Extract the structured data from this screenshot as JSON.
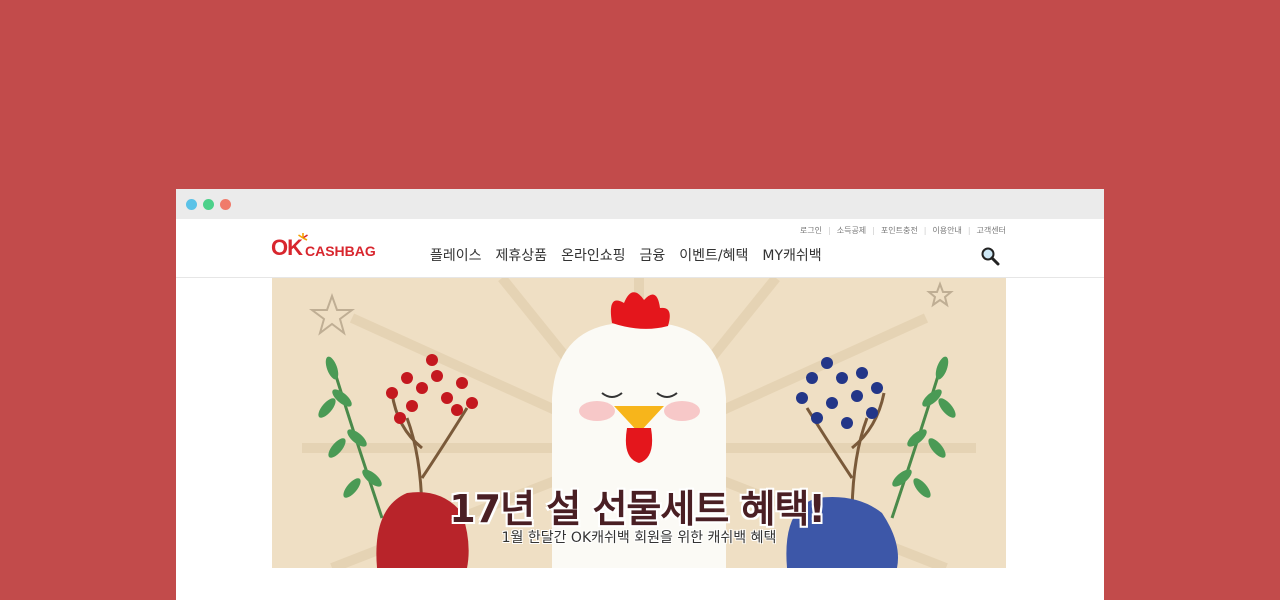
{
  "window": {
    "controls": [
      "close",
      "minimize",
      "maximize"
    ]
  },
  "utility_links": [
    "로그인",
    "소득공제",
    "포인트충전",
    "이용안내",
    "고객센터"
  ],
  "logo": {
    "ok": "OK",
    "cashbag": "CASHBAG"
  },
  "nav": [
    "플레이스",
    "제휴상품",
    "온라인쇼핑",
    "금융",
    "이벤트/혜택",
    "MY캐쉬백"
  ],
  "search": {
    "icon": "search-icon"
  },
  "banner": {
    "headline": "17년 설 선물세트 혜택!",
    "subline": "1월 한달간 OK캐쉬백 회원을 위한 캐쉬백 혜택"
  },
  "colors": {
    "background": "#c24b4b",
    "brand": "#d8262e",
    "banner": "#efdfc4"
  }
}
